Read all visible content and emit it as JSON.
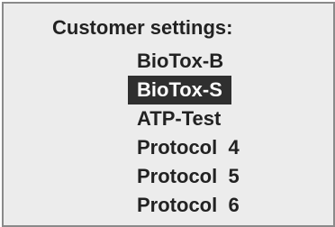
{
  "panel": {
    "title": "Customer settings:",
    "items": [
      {
        "label": "BioTox-B",
        "selected": false
      },
      {
        "label": "BioTox-S",
        "selected": true
      },
      {
        "label": "ATP-Test",
        "selected": false
      },
      {
        "label": "Protocol  4",
        "selected": false
      },
      {
        "label": "Protocol  5",
        "selected": false
      },
      {
        "label": "Protocol  6",
        "selected": false
      }
    ]
  }
}
